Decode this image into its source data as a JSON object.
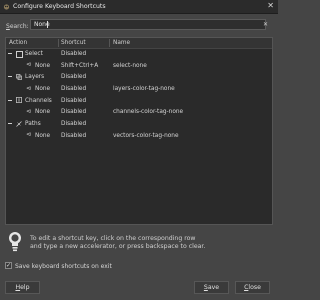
{
  "window": {
    "title": "Configure Keyboard Shortcuts",
    "close_glyph": "✕"
  },
  "search": {
    "label_accel": "S",
    "label_rest": "earch:",
    "value": "None",
    "clear_glyph": "✕"
  },
  "table": {
    "headers": {
      "action": "Action",
      "shortcut": "Shortcut",
      "name": "Name"
    },
    "rows": [
      {
        "kind": "category",
        "icon": "select-icon",
        "action": "Select",
        "shortcut": "Disabled",
        "name": ""
      },
      {
        "kind": "item",
        "icon": "action-icon",
        "action": "None",
        "shortcut": "Shift+Ctrl+A",
        "name": "select-none"
      },
      {
        "kind": "category",
        "icon": "layers-icon",
        "action": "Layers",
        "shortcut": "Disabled",
        "name": ""
      },
      {
        "kind": "item",
        "icon": "action-icon",
        "action": "None",
        "shortcut": "Disabled",
        "name": "layers-color-tag-none"
      },
      {
        "kind": "category",
        "icon": "channels-icon",
        "action": "Channels",
        "shortcut": "Disabled",
        "name": ""
      },
      {
        "kind": "item",
        "icon": "action-icon",
        "action": "None",
        "shortcut": "Disabled",
        "name": "channels-color-tag-none"
      },
      {
        "kind": "category",
        "icon": "paths-icon",
        "action": "Paths",
        "shortcut": "Disabled",
        "name": ""
      },
      {
        "kind": "item",
        "icon": "action-icon",
        "action": "None",
        "shortcut": "Disabled",
        "name": "vectors-color-tag-none"
      }
    ]
  },
  "hint": {
    "line1": "To edit a shortcut key, click on the corresponding row",
    "line2": "and type a new accelerator, or press backspace to clear."
  },
  "save_on_exit": {
    "checked": true,
    "label": "Save keyboard shortcuts on exit",
    "check_glyph": "✓"
  },
  "buttons": {
    "help": {
      "accel": "H",
      "rest": "elp"
    },
    "save": {
      "accel": "S",
      "rest": "ave"
    },
    "close": {
      "accel": "C",
      "rest": "lose"
    }
  }
}
